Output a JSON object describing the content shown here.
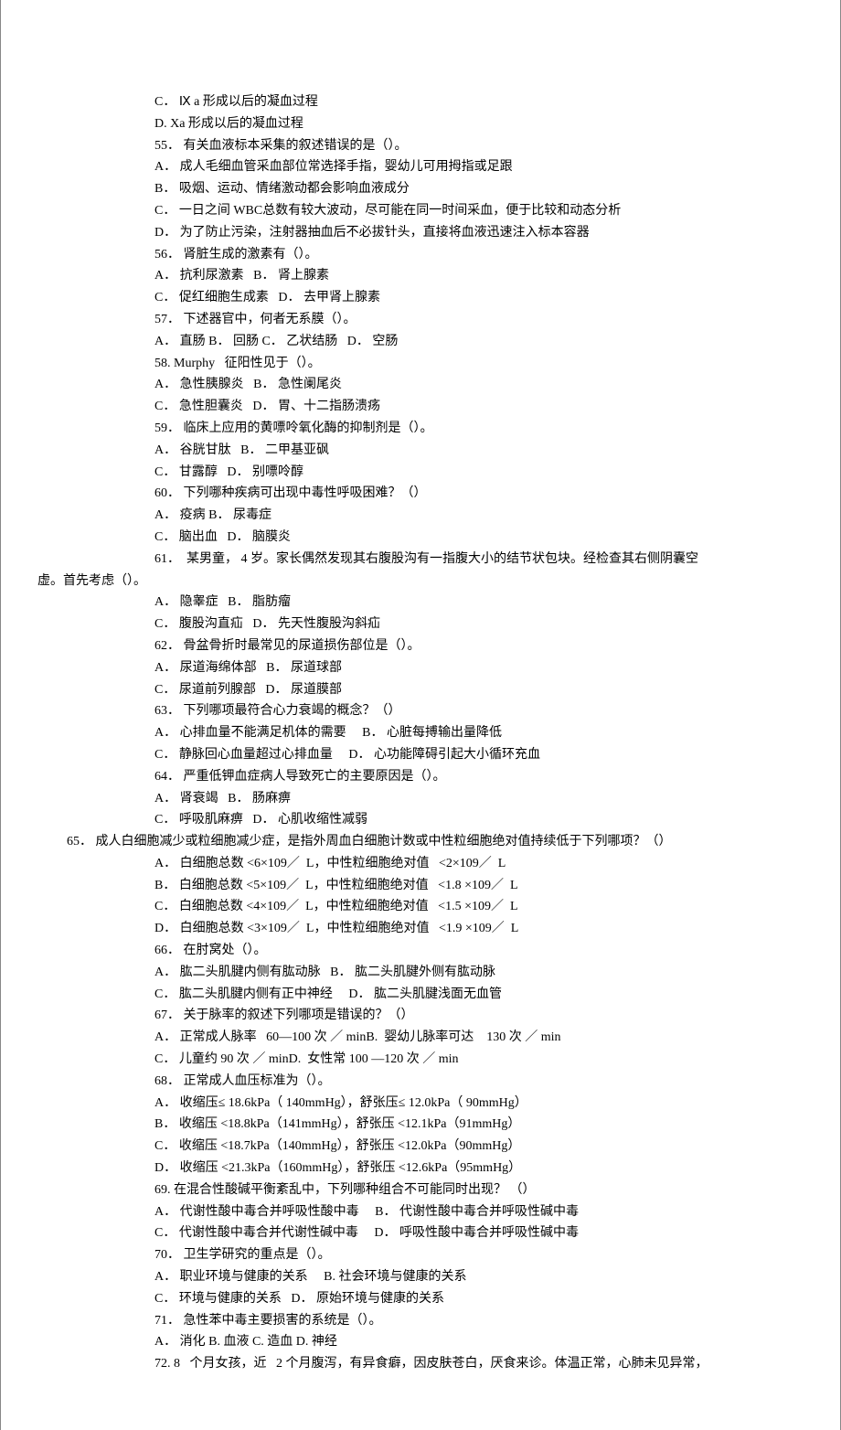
{
  "lines": [
    "C． Ⅸ a 形成以后的凝血过程",
    "D. Xa 形成以后的凝血过程",
    "55． 有关血液标本采集的叙述错误的是（）。",
    "A． 成人毛细血管采血部位常选择手指，婴幼儿可用拇指或足跟",
    "B． 吸烟、运动、情绪激动都会影响血液成分",
    "C． 一日之间 WBC总数有较大波动，尽可能在同一时间采血，便于比较和动态分析",
    "D． 为了防止污染，注射器抽血后不必拔针头，直接将血液迅速注入标本容器",
    "56． 肾脏生成的激素有（）。",
    "A． 抗利尿激素   B． 肾上腺素",
    "C． 促红细胞生成素   D． 去甲肾上腺素",
    "57． 下述器官中，何者无系膜（）。",
    "A． 直肠 B． 回肠 C． 乙状结肠   D． 空肠",
    "58. Murphy   征阳性见于（）。",
    "A． 急性胰腺炎   B． 急性阑尾炎",
    "C． 急性胆囊炎   D． 胃、十二指肠溃疡",
    "59． 临床上应用的黄嘌呤氧化酶的抑制剂是（）。",
    "A． 谷胱甘肽   B． 二甲基亚砜",
    "C． 甘露醇   D． 别嘌呤醇",
    "60． 下列哪种疾病可出现中毒性呼吸困难？（）",
    "A． 疫病 B． 尿毒症",
    "C． 脑出血   D． 脑膜炎",
    "61．  某男童， 4 岁。家长偶然发现其右腹股沟有一指腹大小的结节状包块。经检查其右侧阴囊空"
  ],
  "wrap1": "虚。首先考虑（）。",
  "lines2": [
    "A． 隐睾症   B． 脂肪瘤",
    "C． 腹股沟直疝   D． 先天性腹股沟斜疝",
    "62． 骨盆骨折时最常见的尿道损伤部位是（）。",
    "A． 尿道海绵体部   B． 尿道球部",
    "C． 尿道前列腺部   D． 尿道膜部",
    "63． 下列哪项最符合心力衰竭的概念？（）",
    "A． 心排血量不能满足机体的需要     B． 心脏每搏输出量降低",
    "C． 静脉回心血量超过心排血量     D． 心功能障碍引起大小循环充血",
    "64． 严重低钾血症病人导致死亡的主要原因是（）。",
    "A． 肾衰竭   B． 肠麻痹",
    "C． 呼吸肌麻痹   D． 心肌收缩性减弱"
  ],
  "q65": "65． 成人白细胞减少或粒细胞减少症，是指外周血白细胞计数或中性粒细胞绝对值持续低于下列哪项？（）",
  "lines3": [
    "A． 白细胞总数 <6×109／  L，中性粒细胞绝对值   <2×109／  L",
    "B． 白细胞总数 <5×109／  L，中性粒细胞绝对值   <1.8 ×109／  L",
    "C． 白细胞总数 <4×109／  L，中性粒细胞绝对值   <1.5 ×109／  L",
    "D． 白细胞总数 <3×109／  L，中性粒细胞绝对值   <1.9 ×109／  L",
    "66． 在肘窝处（）。",
    "A． 肱二头肌腱内侧有肱动脉   B． 肱二头肌腱外侧有肱动脉",
    "C． 肱二头肌腱内侧有正中神经     D． 肱二头肌腱浅面无血管",
    "67． 关于脉率的叙述下列哪项是错误的？（）",
    "A． 正常成人脉率   60—100 次 ／ minB.  婴幼儿脉率可达    130 次 ／ min",
    "C． 儿童约 90 次 ／ minD.  女性常 100 —120 次 ／ min",
    "68． 正常成人血压标准为（）。",
    "A． 收缩压≤ 18.6kPa（ 140mmHg），舒张压≤ 12.0kPa（ 90mmHg）",
    "B． 收缩压 <18.8kPa（141mmHg），舒张压 <12.1kPa（91mmHg）",
    "C． 收缩压 <18.7kPa（140mmHg），舒张压 <12.0kPa（90mmHg）",
    "D． 收缩压 <21.3kPa（160mmHg），舒张压 <12.6kPa（95mmHg）",
    "69. 在混合性酸碱平衡紊乱中，下列哪种组合不可能同时出现？ （）",
    "A． 代谢性酸中毒合并呼吸性酸中毒     B． 代谢性酸中毒合并呼吸性碱中毒",
    "C． 代谢性酸中毒合并代谢性碱中毒     D． 呼吸性酸中毒合并呼吸性碱中毒",
    "70． 卫生学研究的重点是（）。",
    "A． 职业环境与健康的关系     B. 社会环境与健康的关系",
    "C． 环境与健康的关系   D． 原始环境与健康的关系",
    "71． 急性苯中毒主要损害的系统是（）。",
    "A． 消化 B. 血液 C. 造血 D. 神经",
    "72. 8   个月女孩，近   2 个月腹泻，有异食癖，因皮肤苍白，厌食来诊。体温正常，心肺未见异常，"
  ]
}
